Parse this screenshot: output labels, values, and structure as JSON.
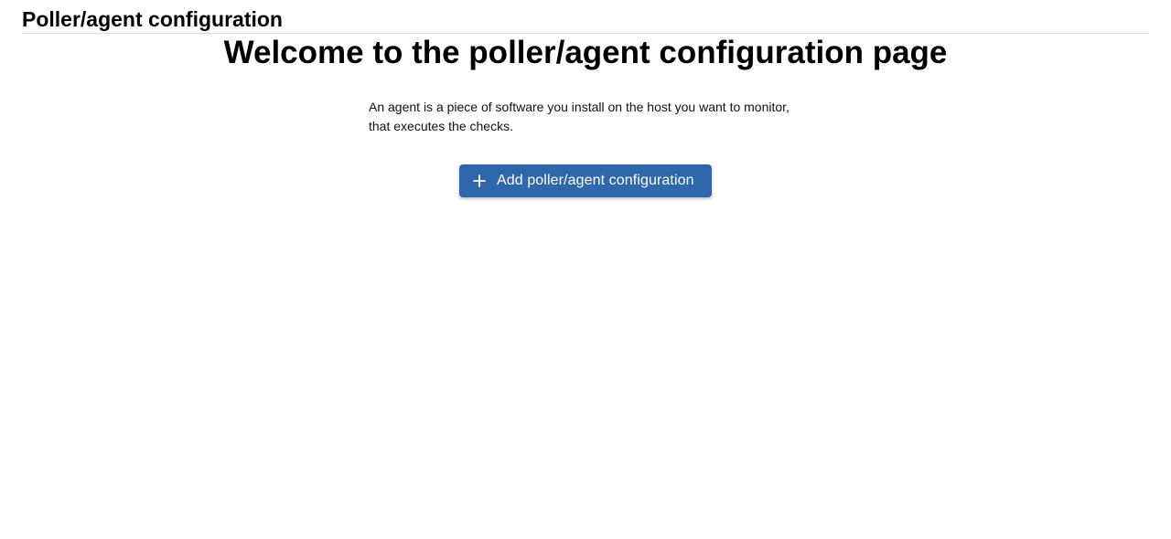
{
  "header": {
    "title": "Poller/agent configuration"
  },
  "main": {
    "welcome_title": "Welcome to the poller/agent configuration page",
    "description_line1": "An agent is a piece of software you install on the host you want to monitor,",
    "description_line2": "that executes the checks.",
    "add_button": {
      "label": "Add poller/agent configuration",
      "icon": "plus-icon",
      "color": "#2e68aa"
    }
  }
}
